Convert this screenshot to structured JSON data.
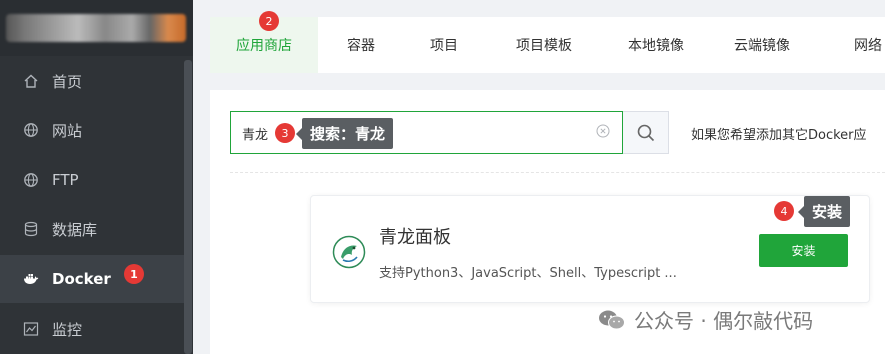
{
  "sidebar": {
    "items": [
      {
        "label": "首页",
        "icon": "home-icon"
      },
      {
        "label": "网站",
        "icon": "globe-icon"
      },
      {
        "label": "FTP",
        "icon": "ftp-icon"
      },
      {
        "label": "数据库",
        "icon": "database-icon"
      },
      {
        "label": "Docker",
        "icon": "docker-icon",
        "active": true
      },
      {
        "label": "监控",
        "icon": "monitor-icon"
      }
    ]
  },
  "tabs": [
    "应用商店",
    "容器",
    "项目",
    "项目模板",
    "本地镜像",
    "云端镜像",
    "网络"
  ],
  "search": {
    "value": "青龙",
    "hint": "如果您希望添加其它Docker应"
  },
  "app": {
    "name": "青龙面板",
    "desc": "支持Python3、JavaScript、Shell、Typescript ...",
    "install_label": "安装"
  },
  "annotations": {
    "step1": "1",
    "step2": "2",
    "step3": "3",
    "step4": "4",
    "tip_search": "搜索：青龙",
    "tip_install": "安装"
  },
  "watermark": "公众号 · 偶尔敲代码",
  "colors": {
    "accent": "#20a53a",
    "sidebar": "#2f3337",
    "badge": "#e53935"
  }
}
